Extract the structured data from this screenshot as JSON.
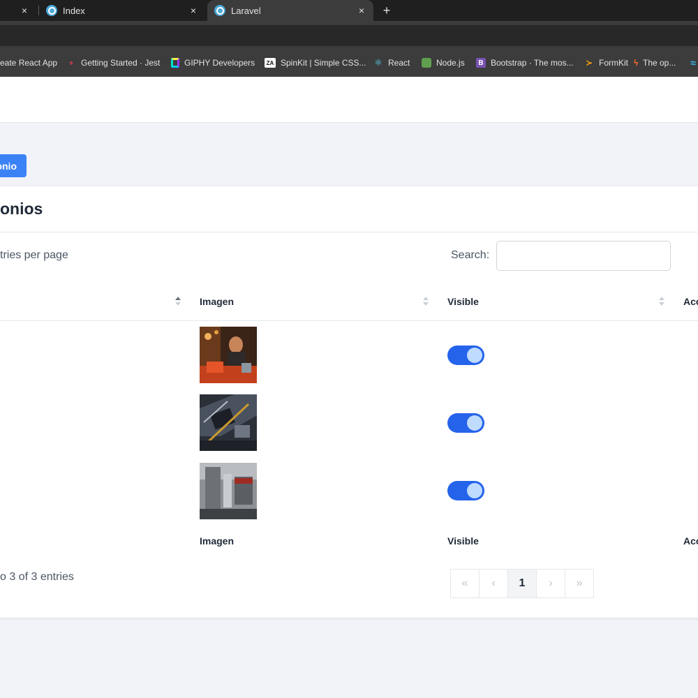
{
  "browser": {
    "tabs": [
      {
        "label": "Index"
      },
      {
        "label": "Laravel"
      }
    ],
    "close_symbol": "×",
    "new_tab_symbol": "+",
    "bookmarks": [
      {
        "label": "eate React App",
        "icon": "react-app-icon"
      },
      {
        "label": "Getting Started · Jest",
        "icon": "jest-icon"
      },
      {
        "label": "GIPHY Developers",
        "icon": "giphy-icon"
      },
      {
        "label": "SpinKit | Simple CSS...",
        "icon": "spinkit-icon"
      },
      {
        "label": "React",
        "icon": "react-icon"
      },
      {
        "label": "Node.js",
        "icon": "nodejs-icon"
      },
      {
        "label": "Bootstrap · The mos...",
        "icon": "bootstrap-icon"
      },
      {
        "label": "FormKit",
        "icon": "formkit-icon"
      },
      {
        "label": "The op...",
        "icon": "bolt-icon"
      }
    ]
  },
  "page": {
    "primary_button": "onio",
    "card_title": "onios",
    "per_page_text": "tries per page",
    "search_label": "Search:",
    "search_value": "",
    "columns": [
      {
        "label": "Imagen"
      },
      {
        "label": "Visible"
      },
      {
        "label": "Acc"
      }
    ],
    "rows": [
      {
        "image": "person-at-desk-photo",
        "visible": true
      },
      {
        "image": "circuit-board-photo",
        "visible": true
      },
      {
        "image": "machine-part-photo",
        "visible": true
      }
    ],
    "info_text": "o 3 of 3 entries",
    "pagination": {
      "first": "«",
      "prev": "‹",
      "current": "1",
      "next": "›",
      "last": "»"
    },
    "colors": {
      "primary": "#3b82f6",
      "toggle_on": "#2563eb"
    }
  }
}
